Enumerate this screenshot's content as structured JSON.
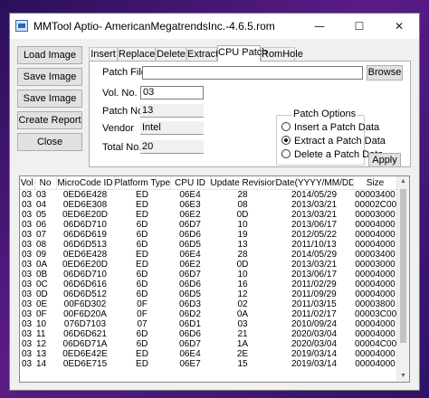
{
  "window": {
    "title": "MMTool Aptio- AmericanMegatrendsInc.-4.6.5.rom",
    "min_glyph": "—",
    "max_glyph": "☐",
    "close_glyph": "✕"
  },
  "left_buttons": [
    "Load Image",
    "Save Image",
    "Save Image as..",
    "Create Report",
    "Close"
  ],
  "tabs": [
    "Insert",
    "Replace",
    "Delete",
    "Extract",
    "CPU Patch",
    "RomHole"
  ],
  "active_tab": "CPU Patch",
  "patch": {
    "file_label": "Patch File",
    "file_value": "",
    "browse_label": "Browse",
    "vol_label": "Vol. No.",
    "vol_value": "03",
    "patchno_label": "Patch No.",
    "patchno_value": "13",
    "vendor_label": "Vendor",
    "vendor_value": "Intel",
    "total_label": "Total No.",
    "total_value": "20",
    "options_title": "Patch Options",
    "options": [
      "Insert a Patch Data",
      "Extract a Patch Data",
      "Delete a Patch Data"
    ],
    "selected_option": "Extract a Patch Data",
    "apply_label": "Apply"
  },
  "table": {
    "columns": [
      "Vol",
      "No",
      "MicroCode ID",
      "Platform Type",
      "CPU ID",
      "Update Revision",
      "Date(YYYY/MM/DD)",
      "Size"
    ],
    "rows": [
      [
        "03",
        "03",
        "0ED6E428",
        "ED",
        "06E4",
        "28",
        "2014/05/29",
        "00003400"
      ],
      [
        "03",
        "04",
        "0ED6E308",
        "ED",
        "06E3",
        "08",
        "2013/03/21",
        "00002C00"
      ],
      [
        "03",
        "05",
        "0ED6E20D",
        "ED",
        "06E2",
        "0D",
        "2013/03/21",
        "00003000"
      ],
      [
        "03",
        "06",
        "06D6D710",
        "6D",
        "06D7",
        "10",
        "2013/06/17",
        "00004000"
      ],
      [
        "03",
        "07",
        "06D6D619",
        "6D",
        "06D6",
        "19",
        "2012/05/22",
        "00004000"
      ],
      [
        "03",
        "08",
        "06D6D513",
        "6D",
        "06D5",
        "13",
        "2011/10/13",
        "00004000"
      ],
      [
        "03",
        "09",
        "0ED6E428",
        "ED",
        "06E4",
        "28",
        "2014/05/29",
        "00003400"
      ],
      [
        "03",
        "0A",
        "0ED6E20D",
        "ED",
        "06E2",
        "0D",
        "2013/03/21",
        "00003000"
      ],
      [
        "03",
        "0B",
        "06D6D710",
        "6D",
        "06D7",
        "10",
        "2013/06/17",
        "00004000"
      ],
      [
        "03",
        "0C",
        "06D6D616",
        "6D",
        "06D6",
        "16",
        "2011/02/29",
        "00004000"
      ],
      [
        "03",
        "0D",
        "06D6D512",
        "6D",
        "06D5",
        "12",
        "2011/09/29",
        "00004000"
      ],
      [
        "03",
        "0E",
        "00F6D302",
        "0F",
        "06D3",
        "02",
        "2011/03/15",
        "00003800"
      ],
      [
        "03",
        "0F",
        "00F6D20A",
        "0F",
        "06D2",
        "0A",
        "2011/02/17",
        "00003C00"
      ],
      [
        "03",
        "10",
        "076D7103",
        "07",
        "06D1",
        "03",
        "2010/09/24",
        "00004000"
      ],
      [
        "03",
        "11",
        "06D6D621",
        "6D",
        "06D6",
        "21",
        "2020/03/04",
        "00004000"
      ],
      [
        "03",
        "12",
        "06D6D71A",
        "6D",
        "06D7",
        "1A",
        "2020/03/04",
        "00004C00"
      ],
      [
        "03",
        "13",
        "0ED6E42E",
        "ED",
        "06E4",
        "2E",
        "2019/03/14",
        "00004000"
      ],
      [
        "03",
        "14",
        "0ED6E715",
        "ED",
        "06E7",
        "15",
        "2019/03/14",
        "00004000"
      ]
    ]
  }
}
